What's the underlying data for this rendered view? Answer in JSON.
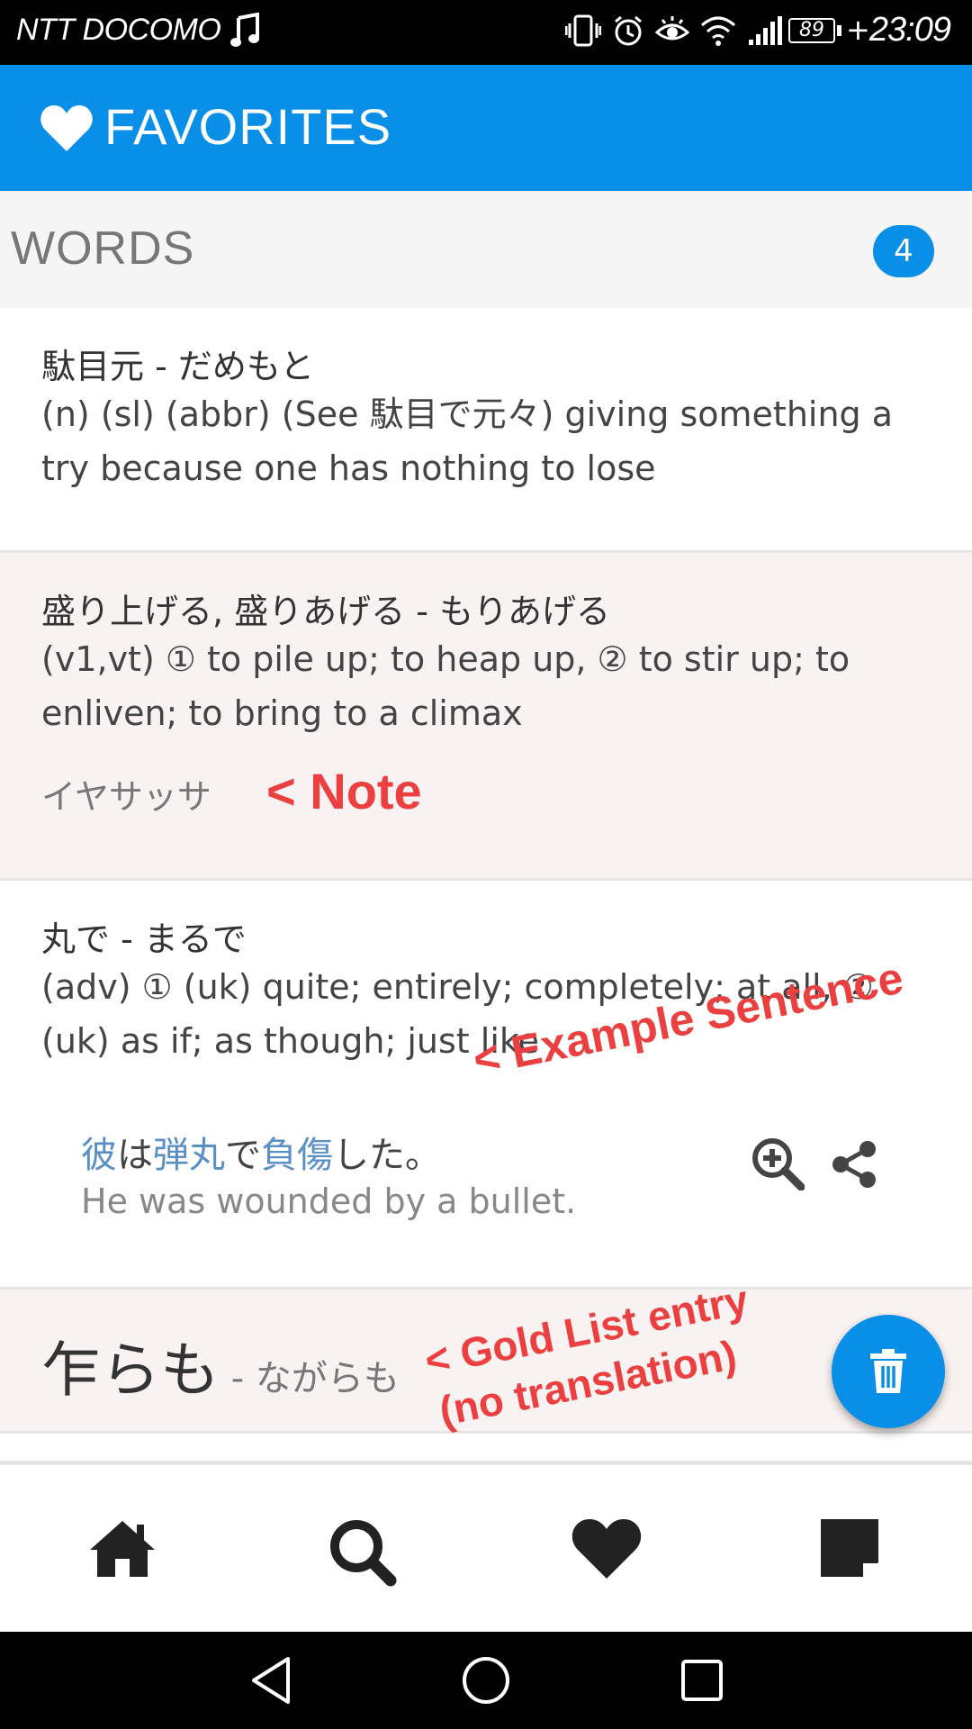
{
  "status_bar": {
    "carrier": "NTT DOCOMO",
    "battery": "89",
    "time": "23:09"
  },
  "header": {
    "title": "FAVORITES",
    "icon": "heart-icon"
  },
  "section": {
    "title": "WORDS",
    "count": "4"
  },
  "entries": [
    {
      "word": "駄目元 - だめもと",
      "definition": "(n) (sl) (abbr) (See 駄目で元々) giving something a try because one has nothing to lose"
    },
    {
      "word": "盛り上げる, 盛りあげる - もりあげる",
      "definition": "(v1,vt) ① to pile up; to heap up, ② to stir up; to enliven; to bring to a climax",
      "note": "イヤサッサ",
      "annotation": "< Note"
    },
    {
      "word": "丸で - まるで",
      "definition": "(adv) ① (uk) quite; entirely; completely; at all, ② (uk) as if; as though; just like",
      "example": {
        "jp_parts": [
          "彼",
          "は",
          "弾丸",
          "で",
          "負傷",
          "した。"
        ],
        "en": "He was wounded by a bullet."
      },
      "annotation": "< Example Sentence"
    },
    {
      "kanji": "乍らも",
      "kana": " - ながらも",
      "annotation_line1": "< Gold List entry",
      "annotation_line2": "(no translation)"
    }
  ],
  "fab": {
    "icon": "trash-icon"
  },
  "bottom_nav": {
    "items": [
      "home-icon",
      "search-icon",
      "heart-icon",
      "note-icon"
    ]
  },
  "colors": {
    "primary": "#0a8fe8",
    "annotation": "#ec4040",
    "tint": "#f9f2f2",
    "link": "#5a8fc4"
  }
}
